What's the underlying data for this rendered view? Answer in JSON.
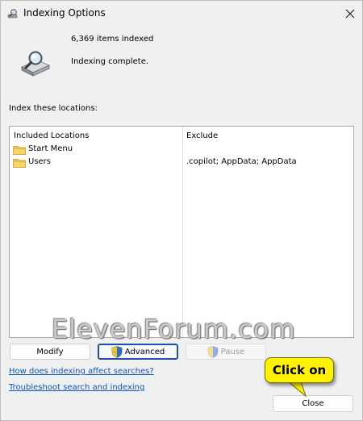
{
  "window": {
    "title": "Indexing Options"
  },
  "status": {
    "items_indexed": "6,369 items indexed",
    "state": "Indexing complete."
  },
  "locations": {
    "label": "Index these locations:",
    "columns": {
      "included": "Included Locations",
      "exclude": "Exclude"
    },
    "rows": [
      {
        "name": "Start Menu",
        "exclude": ""
      },
      {
        "name": "Users",
        "exclude": ".copilot; AppData; AppData"
      }
    ]
  },
  "buttons": {
    "modify": "Modify",
    "advanced": "Advanced",
    "pause": "Pause",
    "close": "Close"
  },
  "links": {
    "how_indexing": "How does indexing affect searches?",
    "troubleshoot": "Troubleshoot search and indexing"
  },
  "watermark": "ElevenForum.com",
  "callout": "Click on",
  "colors": {
    "link": "#0b55c4",
    "callout_bg": "#fff200",
    "folder": "#f2c94c",
    "focus_border": "#1f4fa8"
  },
  "icons": {
    "title": "magnifier-drive-icon",
    "status": "magnifier-drive-icon",
    "folder": "folder-icon",
    "shield": "uac-shield-icon",
    "close": "close-icon"
  }
}
